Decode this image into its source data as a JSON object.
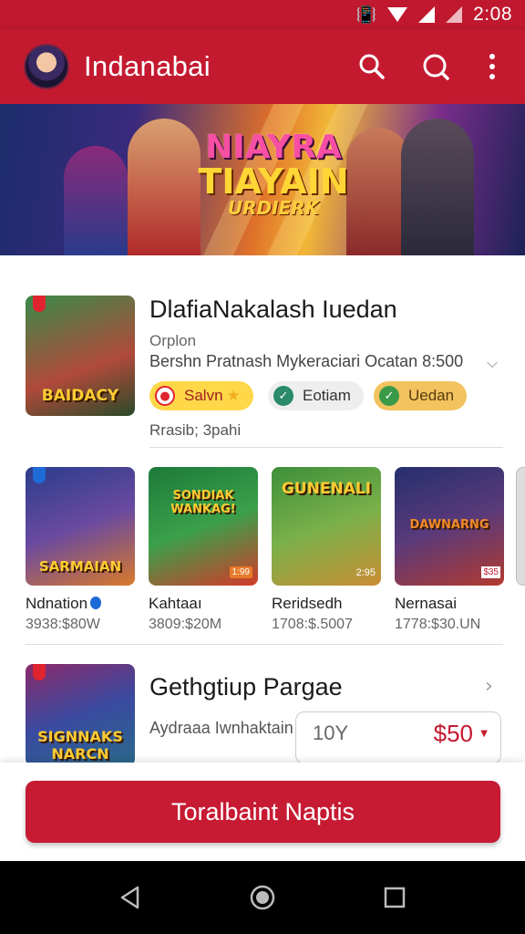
{
  "status_bar": {
    "time": "2:08",
    "icons": [
      "vibrate-icon",
      "wifi-icon",
      "signal-icon",
      "signal-icon"
    ]
  },
  "app_bar": {
    "title": "Indanabai",
    "actions": [
      "search-icon",
      "search-icon",
      "more-vert-icon"
    ]
  },
  "banner": {
    "line1": "NIAYRA",
    "line2": "TIAYAIN",
    "line3": "URDIERK"
  },
  "featured": {
    "thumb_caption": "BAIDACY",
    "title": "DlafiaNakalash Iuedan",
    "subtitle": "Orplon",
    "description": "Bershn Pratnash Mykeraciari Ocatan 8:500",
    "chips": [
      {
        "icon": "shield-icon",
        "label": "Salvn",
        "color": "#ffd84a"
      },
      {
        "icon": "check-icon",
        "label": "Eotiam",
        "color": "#eeeeee"
      },
      {
        "icon": "leaf-icon",
        "label": "Uedan",
        "color": "#f2c35e"
      }
    ],
    "meta": "Rrasib; 3pahi"
  },
  "apps": [
    {
      "caption": "SARMAIAN",
      "name": "Ndnation",
      "price": "3938:$80W",
      "verified": true,
      "colors": [
        "#2a3d8c",
        "#d97a2b"
      ]
    },
    {
      "caption": "SONDIAK WANKAG!",
      "name": "Kahtaaı",
      "price": "3809:$20M",
      "verified": false,
      "colors": [
        "#1c7a3a",
        "#d4392a"
      ],
      "tag": "1:99"
    },
    {
      "caption": "GUNENALI",
      "name": "Reridsedh",
      "price": "1708:$.5007",
      "verified": false,
      "colors": [
        "#3d8f3a",
        "#c98d33"
      ],
      "tag": "2:95"
    },
    {
      "caption": "DAWNARNG",
      "name": "Nernasai",
      "price": "1778:$30.UN",
      "verified": false,
      "colors": [
        "#262f6e",
        "#b23a2f"
      ],
      "tag": "$35"
    }
  ],
  "section2": {
    "thumb_caption": "SIGNNAKS NARCN",
    "title": "Gethgtiup Pargae",
    "description": "Aydraaa Iwnhaktain",
    "price_left": "10Y",
    "price_right": "$50"
  },
  "action_button": {
    "label": "Toralbaint Naptis"
  },
  "nav": [
    "back-icon",
    "home-icon",
    "recents-icon"
  ],
  "colors": {
    "primary": "#c41a30",
    "accent_yellow": "#ffd84a"
  }
}
